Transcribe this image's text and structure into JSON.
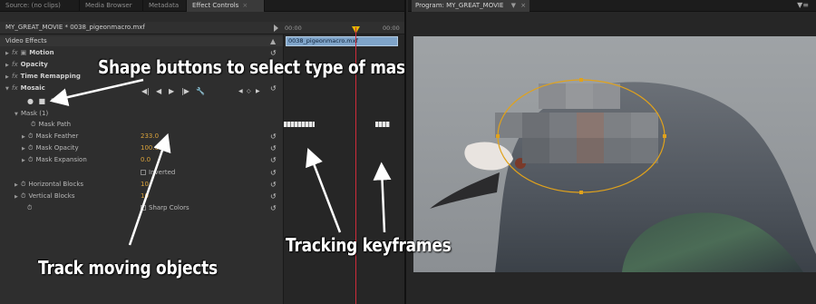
{
  "tabs": [
    {
      "label": "Source: (no clips)",
      "active": false
    },
    {
      "label": "Media Browser",
      "active": false
    },
    {
      "label": "Metadata",
      "active": false
    },
    {
      "label": "Effect Controls",
      "active": true
    }
  ],
  "program_tab": {
    "label": "Program: MY_GREAT_MOVIE",
    "menu_icon": "dropdown-icon"
  },
  "clip_path": "MY_GREAT_MOVIE * 0038_pigeonmacro.mxf",
  "ruler": {
    "start": "00:00",
    "end": "00:00"
  },
  "timeline_clip": "0038_pigeonmacro.mxf",
  "sections": {
    "video_effects": "Video Effects"
  },
  "effects": {
    "motion": "Motion",
    "opacity": "Opacity",
    "time_remapping": "Time Remapping",
    "mosaic": "Mosaic",
    "fx": "fx"
  },
  "mask": {
    "label": "Mask (1)",
    "path": "Mask Path",
    "feather": {
      "label": "Mask Feather",
      "value": "233.0"
    },
    "opacity": {
      "label": "Mask Opacity",
      "value": "100.0"
    },
    "expansion": {
      "label": "Mask Expansion",
      "value": "0.0"
    },
    "inverted": "Inverted"
  },
  "blocks": {
    "horizontal": {
      "label": "Horizontal Blocks",
      "value": "10"
    },
    "vertical": {
      "label": "Vertical Blocks",
      "value": "10"
    },
    "sharp": "Sharp Colors"
  },
  "annotations": {
    "shape_buttons": "Shape buttons to select type of mask",
    "track": "Track moving objects",
    "keyframes": "Tracking keyframes"
  },
  "colors": {
    "accent": "#d9a23b",
    "playhead": "#cf2c3a",
    "clip": "#7fa4c9",
    "mask_outline": "#e0a21c"
  }
}
